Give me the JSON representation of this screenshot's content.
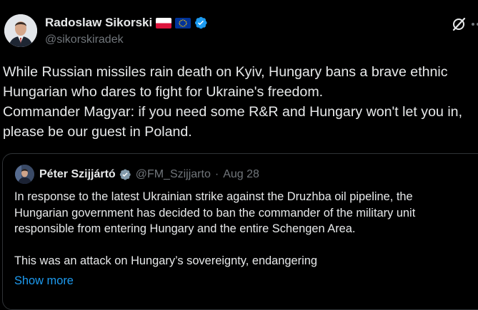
{
  "author": {
    "name": "Radoslaw Sikorski",
    "handle": "@sikorskiradek"
  },
  "tweet": {
    "lines": [
      "While Russian missiles rain death on Kyiv, Hungary bans a brave ethnic",
      "Hungarian who dares to fight for Ukraine's freedom.",
      "Commander Magyar: if you need some R&R and Hungary won't let you in,",
      "please be our guest in Poland."
    ]
  },
  "quote": {
    "name": "Péter Szijjártó",
    "handle": "@FM_Szijjarto",
    "separator": "·",
    "date": "Aug 28",
    "lines": [
      "In response to the latest Ukrainian strike against the Druzhba oil pipeline, the",
      "Hungarian government has decided to ban the commander of the military unit",
      "responsible from entering Hungary and the entire Schengen Area.",
      "",
      "This was an attack on Hungary’s sovereignty, endangering"
    ],
    "show_more": "Show more"
  },
  "colors": {
    "background": "#000000",
    "text": "#e7e9ea",
    "muted": "#71767b",
    "accent": "#1d9bf0",
    "border": "#2f3336"
  },
  "icons": [
    "poland-flag-icon",
    "eu-flag-icon",
    "verified-badge-icon",
    "grok-icon",
    "more-options-icon"
  ]
}
